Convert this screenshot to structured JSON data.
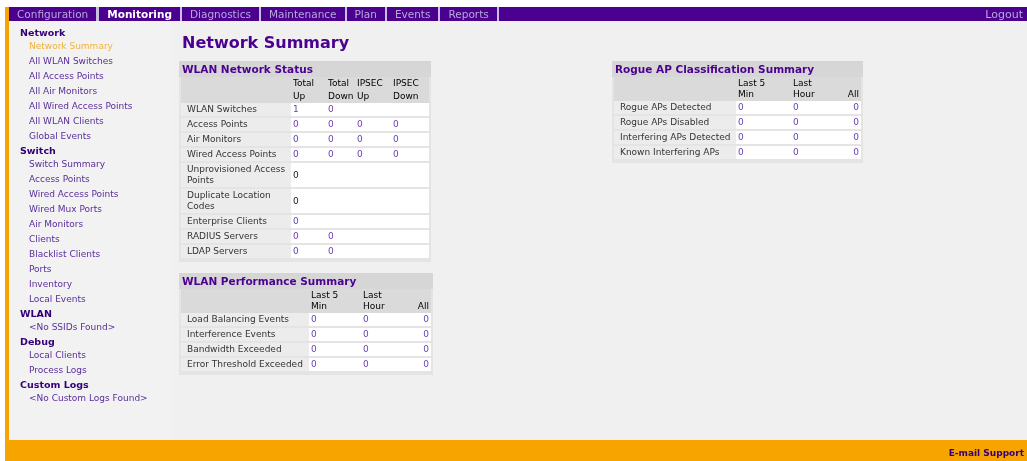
{
  "nav": {
    "tabs": [
      {
        "label": "Configuration",
        "selected": false
      },
      {
        "label": "Monitoring",
        "selected": true
      },
      {
        "label": "Diagnostics",
        "selected": false
      },
      {
        "label": "Maintenance",
        "selected": false
      },
      {
        "label": "Plan",
        "selected": false
      },
      {
        "label": "Events",
        "selected": false
      },
      {
        "label": "Reports",
        "selected": false
      }
    ],
    "logout": "Logout"
  },
  "sidebar": {
    "sections": [
      {
        "title": "Network",
        "items": [
          {
            "label": "Network Summary",
            "selected": true
          },
          {
            "label": "All WLAN Switches",
            "selected": false
          },
          {
            "label": "All Access Points",
            "selected": false
          },
          {
            "label": "All Air Monitors",
            "selected": false
          },
          {
            "label": "All Wired Access Points",
            "selected": false
          },
          {
            "label": "All WLAN Clients",
            "selected": false
          },
          {
            "label": "Global Events",
            "selected": false
          }
        ]
      },
      {
        "title": "Switch",
        "items": [
          {
            "label": "Switch Summary",
            "selected": false
          },
          {
            "label": "Access Points",
            "selected": false
          },
          {
            "label": "Wired Access Points",
            "selected": false
          },
          {
            "label": "Wired Mux Ports",
            "selected": false
          },
          {
            "label": "Air Monitors",
            "selected": false
          },
          {
            "label": "Clients",
            "selected": false
          },
          {
            "label": "Blacklist Clients",
            "selected": false
          },
          {
            "label": "Ports",
            "selected": false
          },
          {
            "label": "Inventory",
            "selected": false
          },
          {
            "label": "Local Events",
            "selected": false
          }
        ]
      },
      {
        "title": "WLAN",
        "items": [
          {
            "label": "<No SSIDs Found>",
            "selected": false
          }
        ]
      },
      {
        "title": "Debug",
        "items": [
          {
            "label": "Local Clients",
            "selected": false
          },
          {
            "label": "Process Logs",
            "selected": false
          }
        ]
      },
      {
        "title": "Custom Logs",
        "items": [
          {
            "label": "<No Custom Logs Found>",
            "selected": false
          }
        ]
      }
    ]
  },
  "page_title": "Network Summary",
  "tables": [
    {
      "title": "WLAN Network Status",
      "header_rows": [
        [
          "Total",
          "Total",
          "IPSEC",
          "IPSEC"
        ],
        [
          "Up",
          "Down",
          "Up",
          "Down"
        ]
      ],
      "rows": [
        {
          "label": "WLAN Switches",
          "values": [
            "1",
            "0"
          ],
          "linked": true
        },
        {
          "label": "Access Points",
          "values": [
            "0",
            "0",
            "0",
            "0"
          ],
          "linked": true
        },
        {
          "label": "Air Monitors",
          "values": [
            "0",
            "0",
            "0",
            "0"
          ],
          "linked": true
        },
        {
          "label": "Wired Access Points",
          "values": [
            "0",
            "0",
            "0",
            "0"
          ],
          "linked": true
        },
        {
          "label": "Unprovisioned Access Points",
          "values": [
            "0"
          ],
          "linked": false
        },
        {
          "label": "Duplicate Location Codes",
          "values": [
            "0"
          ],
          "linked": false
        },
        {
          "label": "Enterprise Clients",
          "values": [
            "0"
          ],
          "linked": true
        },
        {
          "label": "RADIUS Servers",
          "values": [
            "0",
            "0"
          ],
          "linked": true
        },
        {
          "label": "LDAP Servers",
          "values": [
            "0",
            "0"
          ],
          "linked": true
        }
      ]
    },
    {
      "title": "WLAN Performance Summary",
      "header_rows": [
        [
          "Last 5 Min",
          "Last Hour",
          "All"
        ]
      ],
      "rows": [
        {
          "label": "Load Balancing Events",
          "values": [
            "0",
            "0",
            "0"
          ],
          "linked": true
        },
        {
          "label": "Interference Events",
          "values": [
            "0",
            "0",
            "0"
          ],
          "linked": true
        },
        {
          "label": "Bandwidth Exceeded",
          "values": [
            "0",
            "0",
            "0"
          ],
          "linked": true
        },
        {
          "label": "Error Threshold Exceeded",
          "values": [
            "0",
            "0",
            "0"
          ],
          "linked": true
        }
      ]
    },
    {
      "title": "Rogue AP Classification Summary",
      "header_rows": [
        [
          "Last 5 Min",
          "Last Hour",
          "All"
        ]
      ],
      "rows": [
        {
          "label": "Rogue APs Detected",
          "values": [
            "0",
            "0",
            "0"
          ],
          "linked": true
        },
        {
          "label": "Rogue APs Disabled",
          "values": [
            "0",
            "0",
            "0"
          ],
          "linked": true
        },
        {
          "label": "Interfering APs Detected",
          "values": [
            "0",
            "0",
            "0"
          ],
          "linked": true
        },
        {
          "label": "Known Interfering APs",
          "values": [
            "0",
            "0",
            "0"
          ],
          "linked": true
        }
      ]
    }
  ],
  "footer": {
    "link": "E-mail Support"
  }
}
